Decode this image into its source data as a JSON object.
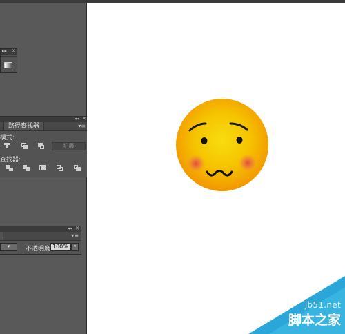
{
  "pathfinder_panel": {
    "tab_label": "路径查找器",
    "shape_modes_label": "模式:",
    "expand_button": "扩展",
    "pathfinders_label": "查找器:"
  },
  "transparency_panel": {
    "opacity_label": "不透明度",
    "opacity_value": "100%"
  },
  "watermark": {
    "site": "jb51.net",
    "brand": "脚本之家"
  },
  "colors": {
    "app_background": "#535353",
    "canvas": "#ffffff",
    "emoji_face_center": "#f5d500",
    "emoji_face_edge": "#f29a00",
    "blush": "#e85a46",
    "watermark_cyan": "#29a9d9"
  }
}
